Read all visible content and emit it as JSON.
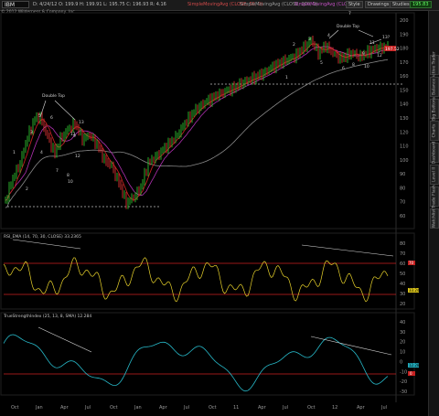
{
  "toolbar": {
    "symbol": "IBM",
    "quote": "D: 4/24/12   O: 199.9   H: 199.91   L: 195.75   C: 196.93   R: 4.16",
    "study1": "SimpleMovingAvg (CLOSE, 50, 0)",
    "study2": "SimpleMovingAvg (CLOSE, 200, 0)",
    "study3": "SimpleMovingAvg (CLOSE, 10, 0)",
    "btn_style": "Style",
    "btn_drawings": "Drawings",
    "btn_studies": "Studies",
    "price_box": "195.83"
  },
  "stamp": "© 2012 Wilderness & Company, Inc.",
  "price_panel": {
    "last_price": "197.52",
    "annotations": {
      "double_top_left": "Double Top",
      "double_top_right": "Double Top",
      "target_label": "13?"
    },
    "wave_labels_left": [
      "1",
      "2",
      "3",
      "4",
      "5",
      "6",
      "7",
      "8",
      "9",
      "10",
      "11",
      "12",
      "13"
    ],
    "wave_labels_right": [
      "1",
      "2",
      "3",
      "4",
      "5",
      "6",
      "7",
      "8",
      "9",
      "10",
      "11",
      "12"
    ],
    "y_ticks": [
      "200",
      "190",
      "180",
      "170",
      "160",
      "150",
      "140",
      "130",
      "120",
      "110",
      "100",
      "90",
      "80",
      "70",
      "60"
    ],
    "colors": {
      "price_up": "#2fbf2f",
      "price_down": "#d33",
      "ma_fast": "#c02020",
      "ma_mid": "#b030b0",
      "ma_slow": "#8a8a8a",
      "dashed": "#bdbdbd"
    }
  },
  "rsi_panel": {
    "title": "RSI_EMA (14, 70, 30, CLOSE)  33.2365",
    "overbought_label": "70",
    "oversold_label": "30",
    "value_label": "33.24",
    "y_ticks": [
      "80",
      "70",
      "60",
      "50",
      "40",
      "30",
      "20"
    ],
    "line_color": "#e8d22a",
    "level_color": "#cc2222"
  },
  "trend_panel": {
    "title": "TrueStrengthIndex (25, 13, 8, SMA)  12.284",
    "value_label": "12.28",
    "zero_label": "0",
    "y_ticks": [
      "40",
      "30",
      "20",
      "10",
      "0",
      "-10",
      "-20",
      "-30"
    ],
    "line_color": "#27b9c9",
    "level_color": "#cc2222"
  },
  "x_axis": [
    "Oct",
    "Jan",
    "Apr",
    "Jul",
    "Oct",
    "Jan",
    "Apr",
    "Jul",
    "Oct",
    "11",
    "Apr",
    "Jul",
    "Oct",
    "12",
    "Apr",
    "Jul"
  ],
  "side_tabs": [
    "Active Trader",
    "Balance",
    "Big Buttons",
    "Charts",
    "Dashboard",
    "Level II",
    "Trade Flash",
    "Watchlist"
  ]
}
